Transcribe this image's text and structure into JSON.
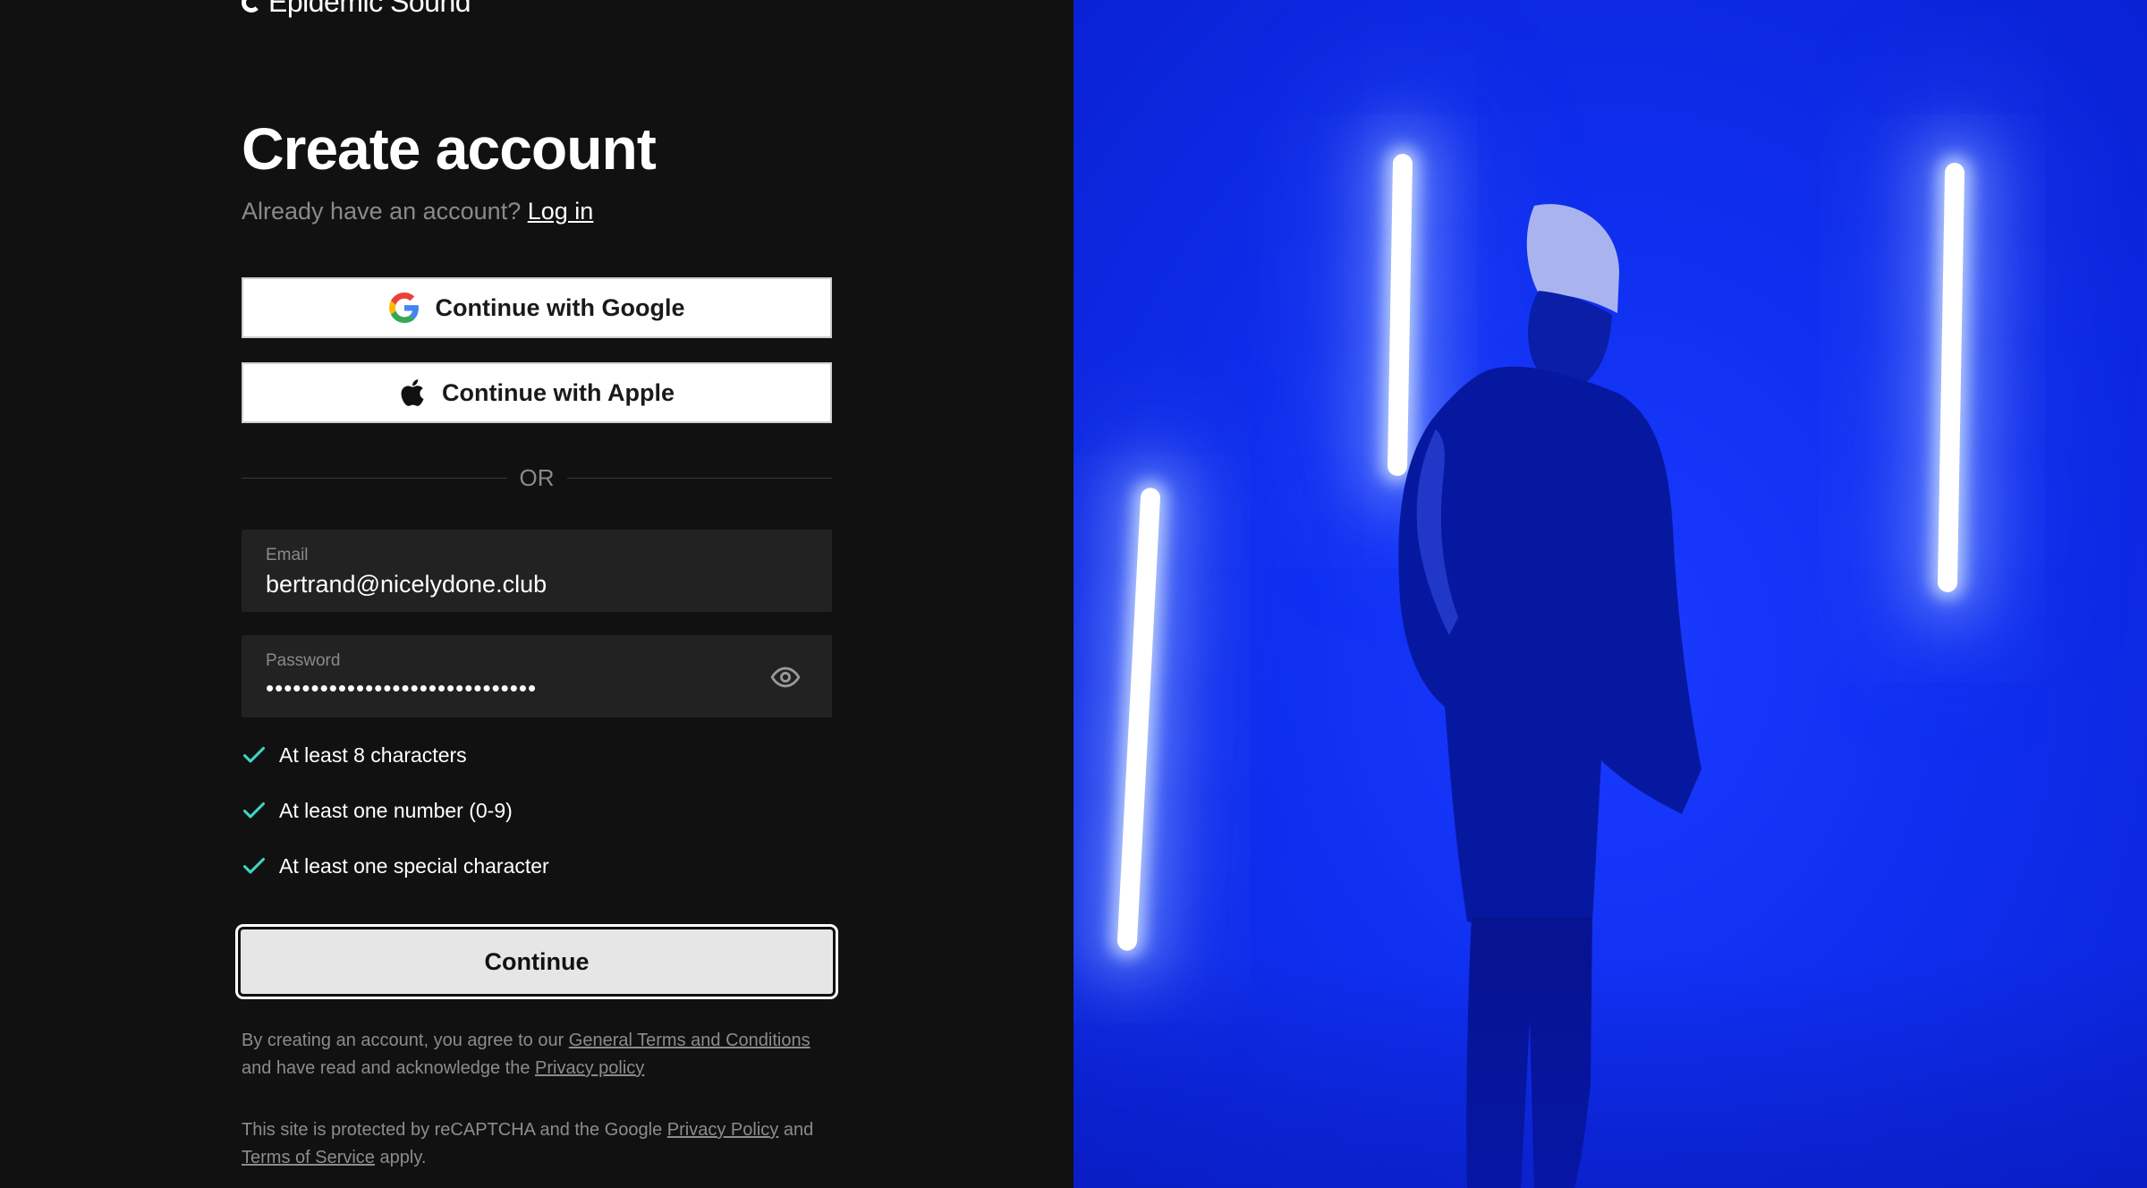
{
  "brand": {
    "name": "Epidemic Sound"
  },
  "header": {
    "title": "Create account",
    "subtitle_prefix": "Already have an account?",
    "login_link": "Log in"
  },
  "sso": {
    "google_label": "Continue with Google",
    "apple_label": "Continue with Apple"
  },
  "divider": {
    "label": "OR"
  },
  "form": {
    "email": {
      "label": "Email",
      "value": "bertrand@nicelydone.club"
    },
    "password": {
      "label": "Password",
      "masked_value": "••••••••••••••••••••••••••••••"
    }
  },
  "password_rules": [
    {
      "label": "At least 8 characters",
      "met": true
    },
    {
      "label": "At least one number (0-9)",
      "met": true
    },
    {
      "label": "At least one special character",
      "met": true
    }
  ],
  "continue_label": "Continue",
  "legal": {
    "terms_prefix": "By creating an account, you agree to our",
    "terms_link": "General Terms and Conditions",
    "terms_middle": "and have read and acknowledge the",
    "privacy_link": "Privacy policy",
    "recaptcha_prefix": "This site is protected by reCAPTCHA and the Google",
    "recaptcha_privacy_link": "Privacy Policy",
    "recaptcha_and": "and",
    "recaptcha_terms_link": "Terms of Service",
    "recaptcha_suffix": "apply."
  },
  "colors": {
    "background": "#111111",
    "check": "#3ed6c1",
    "hero_blue": "#0f2ff0"
  },
  "icons": {
    "google": "google-icon",
    "apple": "apple-icon",
    "eye": "eye-icon",
    "check": "check-icon"
  }
}
